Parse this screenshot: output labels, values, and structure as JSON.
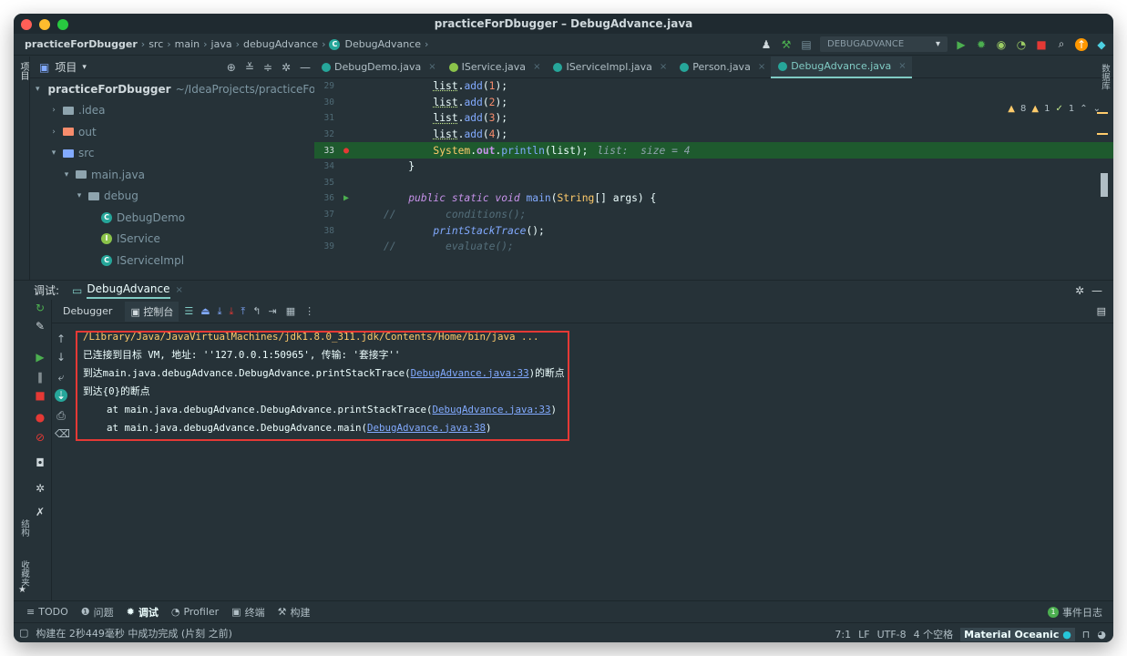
{
  "window": {
    "title": "practiceForDbugger – DebugAdvance.java",
    "colors": {
      "close": "#ff5f57",
      "minimize": "#febc2e",
      "zoom": "#28c840",
      "accent": "#80cbc4"
    }
  },
  "breadcrumb": {
    "items": [
      "practiceForDbugger",
      "src",
      "main",
      "java",
      "debugAdvance",
      "DebugAdvance"
    ]
  },
  "toolbar": {
    "run_config": "DEBUGADVANCE",
    "icons": [
      "user-icon",
      "hammer-icon",
      "run-config-icon",
      "run-icon",
      "debug-icon",
      "coverage-icon",
      "profile-icon",
      "stop-icon",
      "search-icon",
      "update-icon",
      "plugin-icon"
    ]
  },
  "left_strip": {
    "label": "项目"
  },
  "right_strip": {
    "label": "数据库"
  },
  "project_panel": {
    "title": "项目",
    "tree": [
      {
        "label": "practiceForDbugger",
        "suffix": "~/IdeaProjects/practiceForDI",
        "indent": 0,
        "expanded": true,
        "kind": "module"
      },
      {
        "label": ".idea",
        "indent": 1,
        "expanded": false,
        "kind": "folder"
      },
      {
        "label": "out",
        "indent": 1,
        "expanded": false,
        "kind": "folder-orange"
      },
      {
        "label": "src",
        "indent": 1,
        "expanded": true,
        "kind": "folder-blue"
      },
      {
        "label": "main.java",
        "indent": 2,
        "expanded": true,
        "kind": "package"
      },
      {
        "label": "debug",
        "indent": 3,
        "expanded": true,
        "kind": "package"
      },
      {
        "label": "DebugDemo",
        "indent": 4,
        "kind": "class"
      },
      {
        "label": "IService",
        "indent": 4,
        "kind": "interface"
      },
      {
        "label": "IServiceImpl",
        "indent": 4,
        "kind": "class"
      }
    ]
  },
  "editor": {
    "tabs": [
      {
        "label": "DebugDemo.java",
        "active": false,
        "icon": "class"
      },
      {
        "label": "IService.java",
        "active": false,
        "icon": "interface"
      },
      {
        "label": "IServiceImpl.java",
        "active": false,
        "icon": "class"
      },
      {
        "label": "Person.java",
        "active": false,
        "icon": "class"
      },
      {
        "label": "DebugAdvance.java",
        "active": true,
        "icon": "class"
      }
    ],
    "inspection": {
      "warnings": "8",
      "weak_warnings": "1",
      "ok": "1"
    },
    "lines": [
      {
        "num": "29",
        "code": "        list.add(1);"
      },
      {
        "num": "30",
        "code": "        list.add(2);"
      },
      {
        "num": "31",
        "code": "        list.add(3);"
      },
      {
        "num": "32",
        "code": "        list.add(4);"
      },
      {
        "num": "33",
        "code": "        System.out.println(list);",
        "inlay": "list:  size = 4",
        "highlight": true
      },
      {
        "num": "34",
        "code": "    }"
      },
      {
        "num": "35",
        "code": ""
      },
      {
        "num": "36",
        "code": "    public static void main(String[] args) {"
      },
      {
        "num": "37",
        "code": "//        conditions();"
      },
      {
        "num": "38",
        "code": "        printStackTrace();"
      },
      {
        "num": "39",
        "code": "//        evaluate();"
      }
    ]
  },
  "debug": {
    "header_label": "调试:",
    "session": "DebugAdvance",
    "sub_tabs": {
      "debugger": "Debugger",
      "console": "控制台"
    },
    "console_lines": [
      {
        "text": "/Library/Java/JavaVirtualMachines/jdk1.8.0_311.jdk/Contents/Home/bin/java ...",
        "kind": "path"
      },
      {
        "text": "已连接到目标 VM, 地址: ''127.0.0.1:50965', 传输: '套接字''",
        "kind": "plain"
      },
      {
        "pre": "到达main.java.debugAdvance.DebugAdvance.printStackTrace(",
        "link": "DebugAdvance.java:33",
        "post": ")的断点",
        "kind": "link"
      },
      {
        "text": "到达{0}的断点",
        "kind": "plain"
      },
      {
        "pre": "    at main.java.debugAdvance.DebugAdvance.printStackTrace(",
        "link": "DebugAdvance.java:33",
        "post": ")",
        "kind": "link"
      },
      {
        "pre": "    at main.java.debugAdvance.DebugAdvance.main(",
        "link": "DebugAdvance.java:38",
        "post": ")",
        "kind": "link"
      }
    ]
  },
  "side_labels": {
    "structure": "结构",
    "favorites": "收藏夹"
  },
  "bottom_tabs": [
    {
      "label": "TODO",
      "icon": "list-icon"
    },
    {
      "label": "问题",
      "icon": "problem-icon"
    },
    {
      "label": "调试",
      "icon": "bug-icon",
      "active": true
    },
    {
      "label": "Profiler",
      "icon": "profiler-icon"
    },
    {
      "label": "终端",
      "icon": "terminal-icon"
    },
    {
      "label": "构建",
      "icon": "build-icon"
    }
  ],
  "event_log": {
    "count": "1",
    "label": "事件日志"
  },
  "status": {
    "message": "构建在 2秒449毫秒 中成功完成 (片刻 之前)",
    "position": "7:1",
    "line_sep": "LF",
    "encoding": "UTF-8",
    "indent": "4 个空格",
    "theme": "Material Oceanic"
  }
}
